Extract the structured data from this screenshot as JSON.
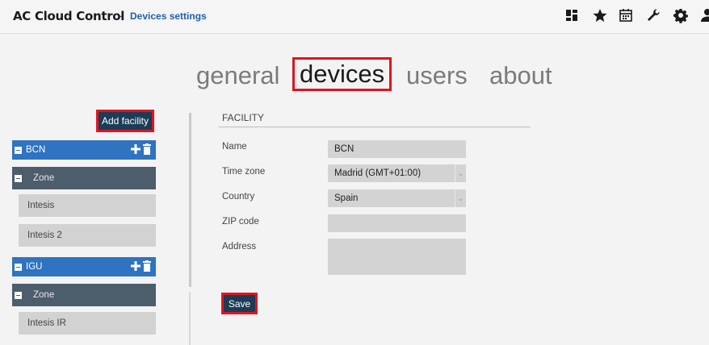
{
  "header": {
    "app_title": "AC Cloud Control",
    "separator": "-",
    "subtitle": "Devices settings",
    "icons": [
      "dashboard-icon",
      "star-icon",
      "calendar-icon",
      "wrench-icon",
      "gear-icon",
      "user-icon"
    ]
  },
  "tabs": [
    {
      "label": "general",
      "active": false
    },
    {
      "label": "devices",
      "active": true
    },
    {
      "label": "users",
      "active": false
    },
    {
      "label": "about",
      "active": false
    }
  ],
  "sidebar": {
    "add_facility_label": "Add facility",
    "facilities": [
      {
        "name": "BCN",
        "zone": "Zone",
        "devices": [
          "Intesis",
          "Intesis 2"
        ]
      },
      {
        "name": "IGU",
        "zone": "Zone",
        "devices": [
          "Intesis IR"
        ]
      }
    ]
  },
  "form": {
    "section_title": "FACILITY",
    "name_label": "Name",
    "name_value": "BCN",
    "timezone_label": "Time zone",
    "timezone_value": "Madrid (GMT+01:00)",
    "country_label": "Country",
    "country_value": "Spain",
    "zip_label": "ZIP code",
    "zip_value": "",
    "address_label": "Address",
    "address_value": "",
    "save_label": "Save"
  },
  "colors": {
    "accent_blue": "#2f73c1",
    "zone_gray": "#4c5d6c",
    "button_dark": "#1b3c57",
    "highlight_red": "#e0141e"
  }
}
